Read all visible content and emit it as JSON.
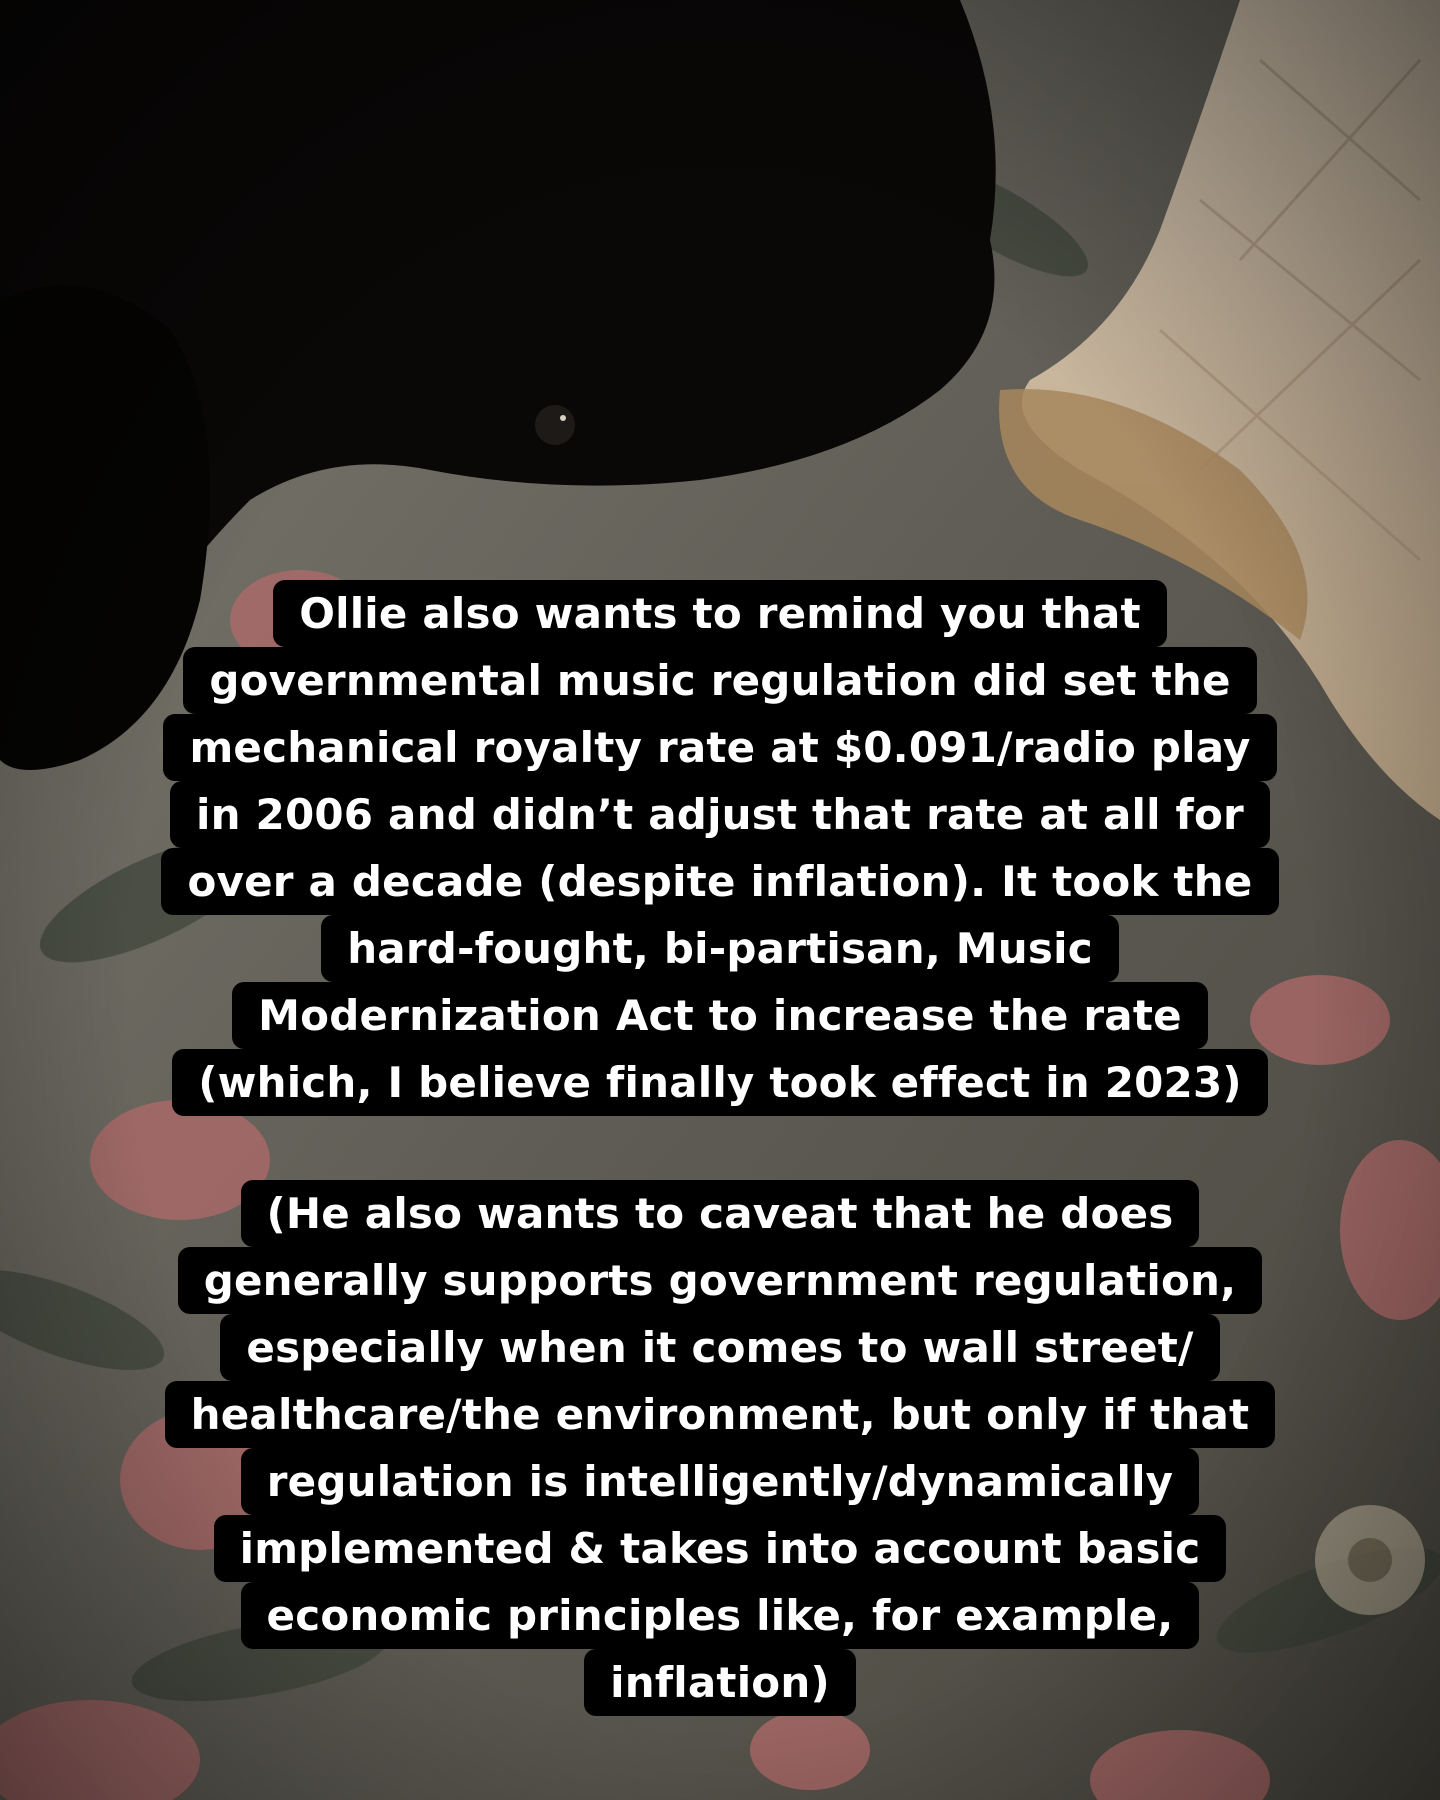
{
  "story": {
    "caption_1": {
      "lines": [
        "Ollie also wants to remind you that",
        "governmental music regulation did set the",
        "mechanical royalty rate at $0.091/radio play",
        "in 2006 and didn’t adjust that rate at all for",
        "over a decade (despite inflation). It took the",
        "hard-fought, bi-partisan, Music",
        "Modernization Act to increase the rate",
        "(which, I believe finally took effect in 2023)"
      ]
    },
    "caption_2": {
      "lines": [
        "(He also wants to caveat that he does",
        "generally supports government regulation,",
        "especially when it comes to wall street/",
        "healthcare/the environment, but only if that",
        "regulation is intelligently/dynamically",
        "implemented & takes into account basic",
        "economic principles like, for example,",
        "inflation)"
      ]
    }
  }
}
